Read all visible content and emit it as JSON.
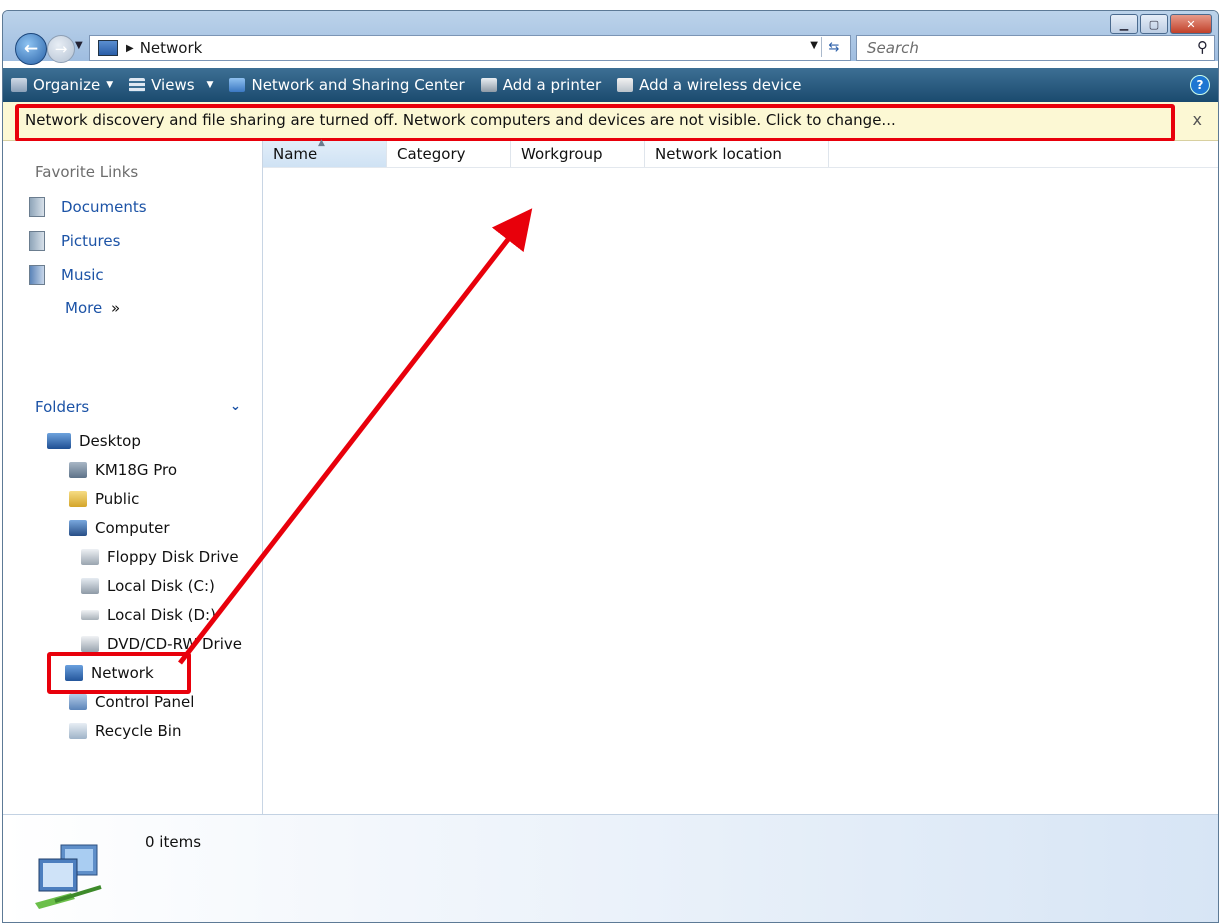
{
  "window": {
    "caption_buttons": [
      "minimize",
      "maximize",
      "close"
    ]
  },
  "nav": {
    "address_text": "Network",
    "search_placeholder": "Search"
  },
  "toolbar": {
    "organize": "Organize",
    "views": "Views",
    "network_sharing": "Network and Sharing Center",
    "add_printer": "Add a printer",
    "add_wireless": "Add a wireless device"
  },
  "infobar": {
    "message": "Network discovery and file sharing are turned off. Network computers and devices are not visible. Click to change...",
    "close": "x"
  },
  "sidebar": {
    "favorite_links_title": "Favorite Links",
    "links": [
      {
        "label": "Documents"
      },
      {
        "label": "Pictures"
      },
      {
        "label": "Music"
      }
    ],
    "more_label": "More",
    "more_glyph": "»",
    "folders_title": "Folders",
    "tree": [
      {
        "label": "Desktop"
      },
      {
        "label": "KM18G Pro"
      },
      {
        "label": "Public"
      },
      {
        "label": "Computer"
      },
      {
        "label": "Floppy Disk Drive"
      },
      {
        "label": "Local Disk (C:)"
      },
      {
        "label": "Local Disk (D:)"
      },
      {
        "label": "DVD/CD-RW Drive"
      },
      {
        "label": "Network"
      },
      {
        "label": "Control Panel"
      },
      {
        "label": "Recycle Bin"
      }
    ]
  },
  "content": {
    "columns": [
      "Name",
      "Category",
      "Workgroup",
      "Network location"
    ]
  },
  "details": {
    "item_count": "0 items"
  },
  "annotation_color": "#e8000b"
}
